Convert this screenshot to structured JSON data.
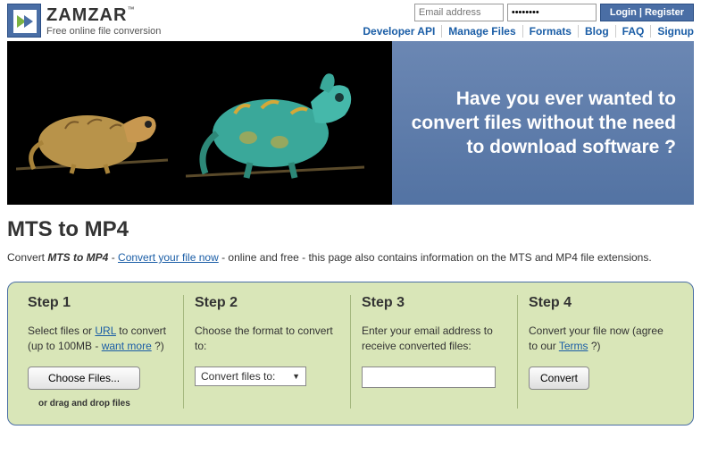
{
  "brand": {
    "name": "ZAMZAR",
    "tm": "™",
    "tagline": "Free online file conversion"
  },
  "login": {
    "email_placeholder": "Email address",
    "pw_value": "••••••••",
    "button": "Login | Register"
  },
  "nav": {
    "dev": "Developer API",
    "manage": "Manage Files",
    "formats": "Formats",
    "blog": "Blog",
    "faq": "FAQ",
    "signup": "Signup"
  },
  "hero": {
    "text": "Have you ever wanted to convert files without the need to download software ?"
  },
  "page": {
    "title": "MTS to MP4",
    "sub_prefix": "Convert ",
    "sub_bold": "MTS to MP4",
    "sub_dash": " - ",
    "sub_link": "Convert your file now",
    "sub_rest": " - online and free - this page also contains information on the MTS and MP4 file extensions."
  },
  "steps": {
    "s1": {
      "h": "Step 1",
      "p1": "Select files or ",
      "url": "URL",
      "p2": " to convert (up to 100MB - ",
      "more": "want more",
      "p3": " ?)",
      "btn": "Choose Files...",
      "drag": "or drag and drop files"
    },
    "s2": {
      "h": "Step 2",
      "p": "Choose the format to convert to:",
      "select": "Convert files to:"
    },
    "s3": {
      "h": "Step 3",
      "p": "Enter your email address to receive converted files:"
    },
    "s4": {
      "h": "Step 4",
      "p1": "Convert your file now (agree to our ",
      "terms": "Terms",
      "p2": " ?)",
      "btn": "Convert"
    }
  }
}
